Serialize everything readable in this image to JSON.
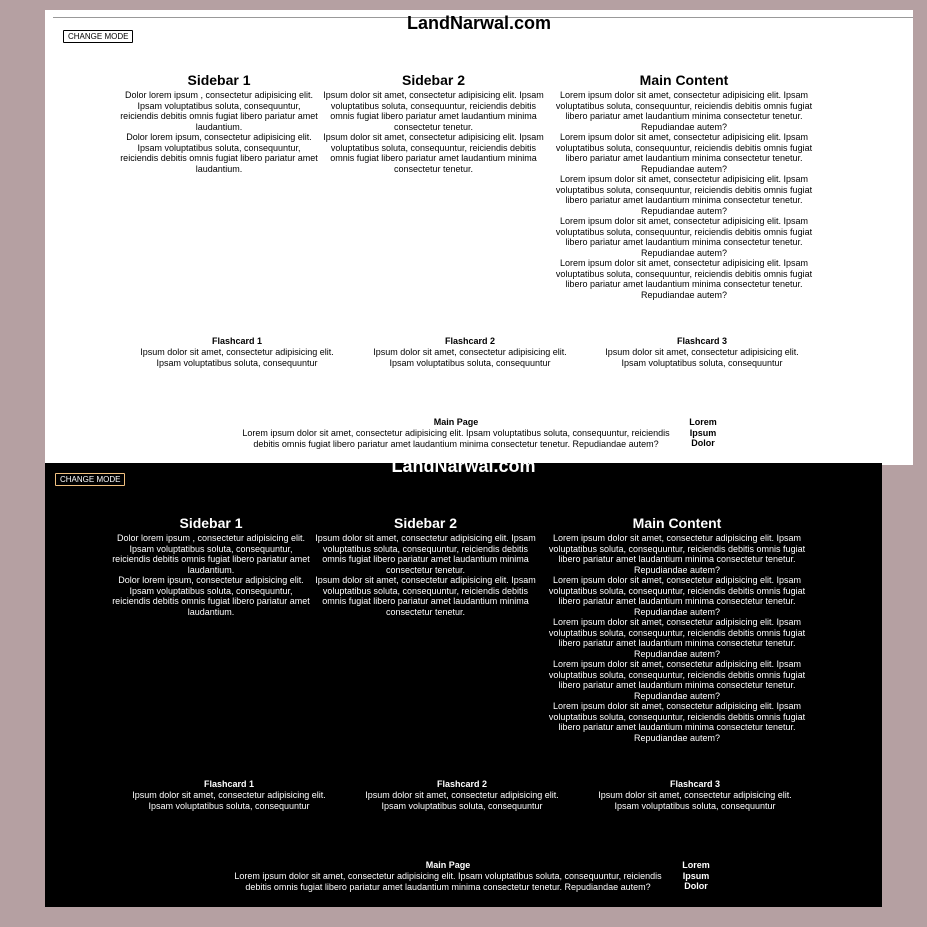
{
  "site_title": "LandNarwal.com",
  "mode_button": "CHANGE MODE",
  "sidebar1": {
    "title": "Sidebar 1",
    "paragraphs": [
      "Dolor lorem ipsum , consectetur adipisicing elit. Ipsam voluptatibus soluta, consequuntur, reiciendis debitis omnis fugiat libero pariatur amet laudantium.",
      "Dolor lorem ipsum, consectetur adipisicing elit. Ipsam voluptatibus soluta, consequuntur, reiciendis debitis omnis fugiat libero pariatur amet laudantium."
    ]
  },
  "sidebar2": {
    "title": "Sidebar 2",
    "paragraphs": [
      "Ipsum dolor sit amet, consectetur adipisicing elit. Ipsam voluptatibus soluta, consequuntur, reiciendis debitis omnis fugiat libero pariatur amet laudantium minima consectetur tenetur.",
      "Ipsum dolor sit amet, consectetur adipisicing elit. Ipsam voluptatibus soluta, consequuntur, reiciendis debitis omnis fugiat libero pariatur amet laudantium minima consectetur tenetur."
    ]
  },
  "main_content": {
    "title": "Main Content",
    "paragraphs": [
      "Lorem ipsum dolor sit amet, consectetur adipisicing elit. Ipsam voluptatibus soluta, consequuntur, reiciendis debitis omnis fugiat libero pariatur amet laudantium minima consectetur tenetur. Repudiandae autem?",
      "Lorem ipsum dolor sit amet, consectetur adipisicing elit. Ipsam voluptatibus soluta, consequuntur, reiciendis debitis omnis fugiat libero pariatur amet laudantium minima consectetur tenetur. Repudiandae autem?",
      "Lorem ipsum dolor sit amet, consectetur adipisicing elit. Ipsam voluptatibus soluta, consequuntur, reiciendis debitis omnis fugiat libero pariatur amet laudantium minima consectetur tenetur. Repudiandae autem?",
      "Lorem ipsum dolor sit amet, consectetur adipisicing elit. Ipsam voluptatibus soluta, consequuntur, reiciendis debitis omnis fugiat libero pariatur amet laudantium minima consectetur tenetur. Repudiandae autem?",
      "Lorem ipsum dolor sit amet, consectetur adipisicing elit. Ipsam voluptatibus soluta, consequuntur, reiciendis debitis omnis fugiat libero pariatur amet laudantium minima consectetur tenetur. Repudiandae autem?"
    ]
  },
  "flashcards": [
    {
      "title": "Flashcard 1",
      "text": "Ipsum dolor sit amet, consectetur adipisicing elit. Ipsam voluptatibus soluta, consequuntur"
    },
    {
      "title": "Flashcard 2",
      "text": "Ipsum dolor sit amet, consectetur adipisicing elit. Ipsam voluptatibus soluta, consequuntur"
    },
    {
      "title": "Flashcard 3",
      "text": "Ipsum dolor sit amet, consectetur adipisicing elit. Ipsam voluptatibus soluta, consequuntur"
    }
  ],
  "main_page": {
    "title": "Main Page",
    "text": "Lorem ipsum dolor sit amet, consectetur adipisicing elit. Ipsam voluptatibus soluta, consequuntur, reiciendis debitis omnis fugiat libero pariatur amet laudantium minima consectetur tenetur. Repudiandae autem?"
  },
  "side_words": [
    "Lorem",
    "Ipsum",
    "Dolor"
  ],
  "colors": {
    "outer_background": "#b5a0a2",
    "light_background": "#ffffff",
    "dark_background": "#000000",
    "dark_button_border": "#f0c080"
  }
}
